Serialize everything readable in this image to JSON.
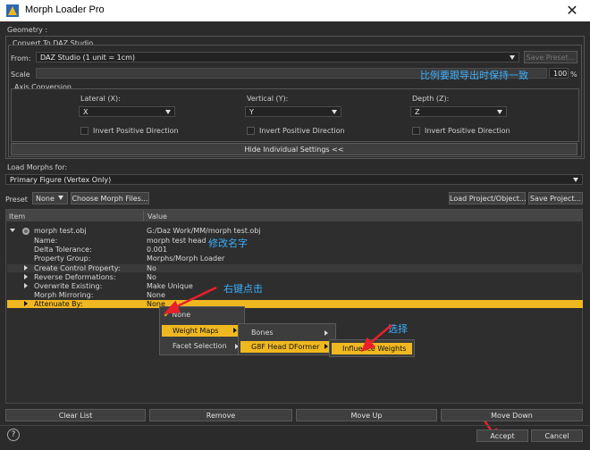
{
  "window": {
    "title": "Morph Loader Pro",
    "close_glyph": "✕"
  },
  "geometry": {
    "section_label": "Geometry :",
    "convert_group": "Convert To DAZ Studio",
    "from_label": "From:",
    "from_value": "DAZ Studio (1 unit = 1cm)",
    "save_preset": "Save Preset...",
    "scale_label": "Scale",
    "scale_value": "100",
    "scale_unit": "%",
    "axis_group": "Axis Conversion",
    "lateral_label": "Lateral (X):",
    "lateral_value": "X",
    "vertical_label": "Vertical (Y):",
    "vertical_value": "Y",
    "depth_label": "Depth (Z):",
    "depth_value": "Z",
    "invert_label": "Invert Positive Direction",
    "hide_settings": "Hide Individual Settings <<"
  },
  "load_morphs": {
    "label": "Load Morphs for:",
    "value": "Primary Figure (Vertex Only)"
  },
  "preset_bar": {
    "preset_label": "Preset",
    "preset_value": "None",
    "choose_files": "Choose Morph Files...",
    "load_project": "Load Project/Object...",
    "save_project": "Save Project..."
  },
  "table": {
    "col_item": "Item",
    "col_value": "Value",
    "root_item": "morph test.obj",
    "root_value": "G:/Daz Work/MM/morph test.obj",
    "rows": [
      {
        "item": "Name:",
        "value": "morph test head"
      },
      {
        "item": "Delta Tolerance:",
        "value": "0.001"
      },
      {
        "item": "Property Group:",
        "value": "Morphs/Morph Loader"
      },
      {
        "item": "Create Control Property:",
        "value": "No"
      },
      {
        "item": "Reverse Deformations:",
        "value": "No"
      },
      {
        "item": "Overwrite Existing:",
        "value": "Make Unique"
      },
      {
        "item": "Morph Mirroring:",
        "value": "None"
      },
      {
        "item": "Attenuate By:",
        "value": "None"
      }
    ]
  },
  "context_menu": {
    "none": "None",
    "weight_maps": "Weight Maps",
    "facet_selection": "Facet Selection",
    "bones": "Bones",
    "g8f_head": "G8F Head DFormer",
    "influence_weights": "Influence Weights",
    "check_glyph": "✔"
  },
  "annotations": {
    "scale_note": "比例要跟导出时保持一致",
    "rename_note": "修改名字",
    "right_click_note": "右键点击",
    "select_note": "选择"
  },
  "bottom": {
    "clear_list": "Clear List",
    "remove": "Remove",
    "move_up": "Move Up",
    "move_down": "Move Down",
    "help": "?",
    "accept": "Accept",
    "cancel": "Cancel"
  },
  "colors": {
    "highlight": "#f0b820",
    "annotation": "#3ab0ff",
    "arrow": "#e8202a"
  }
}
